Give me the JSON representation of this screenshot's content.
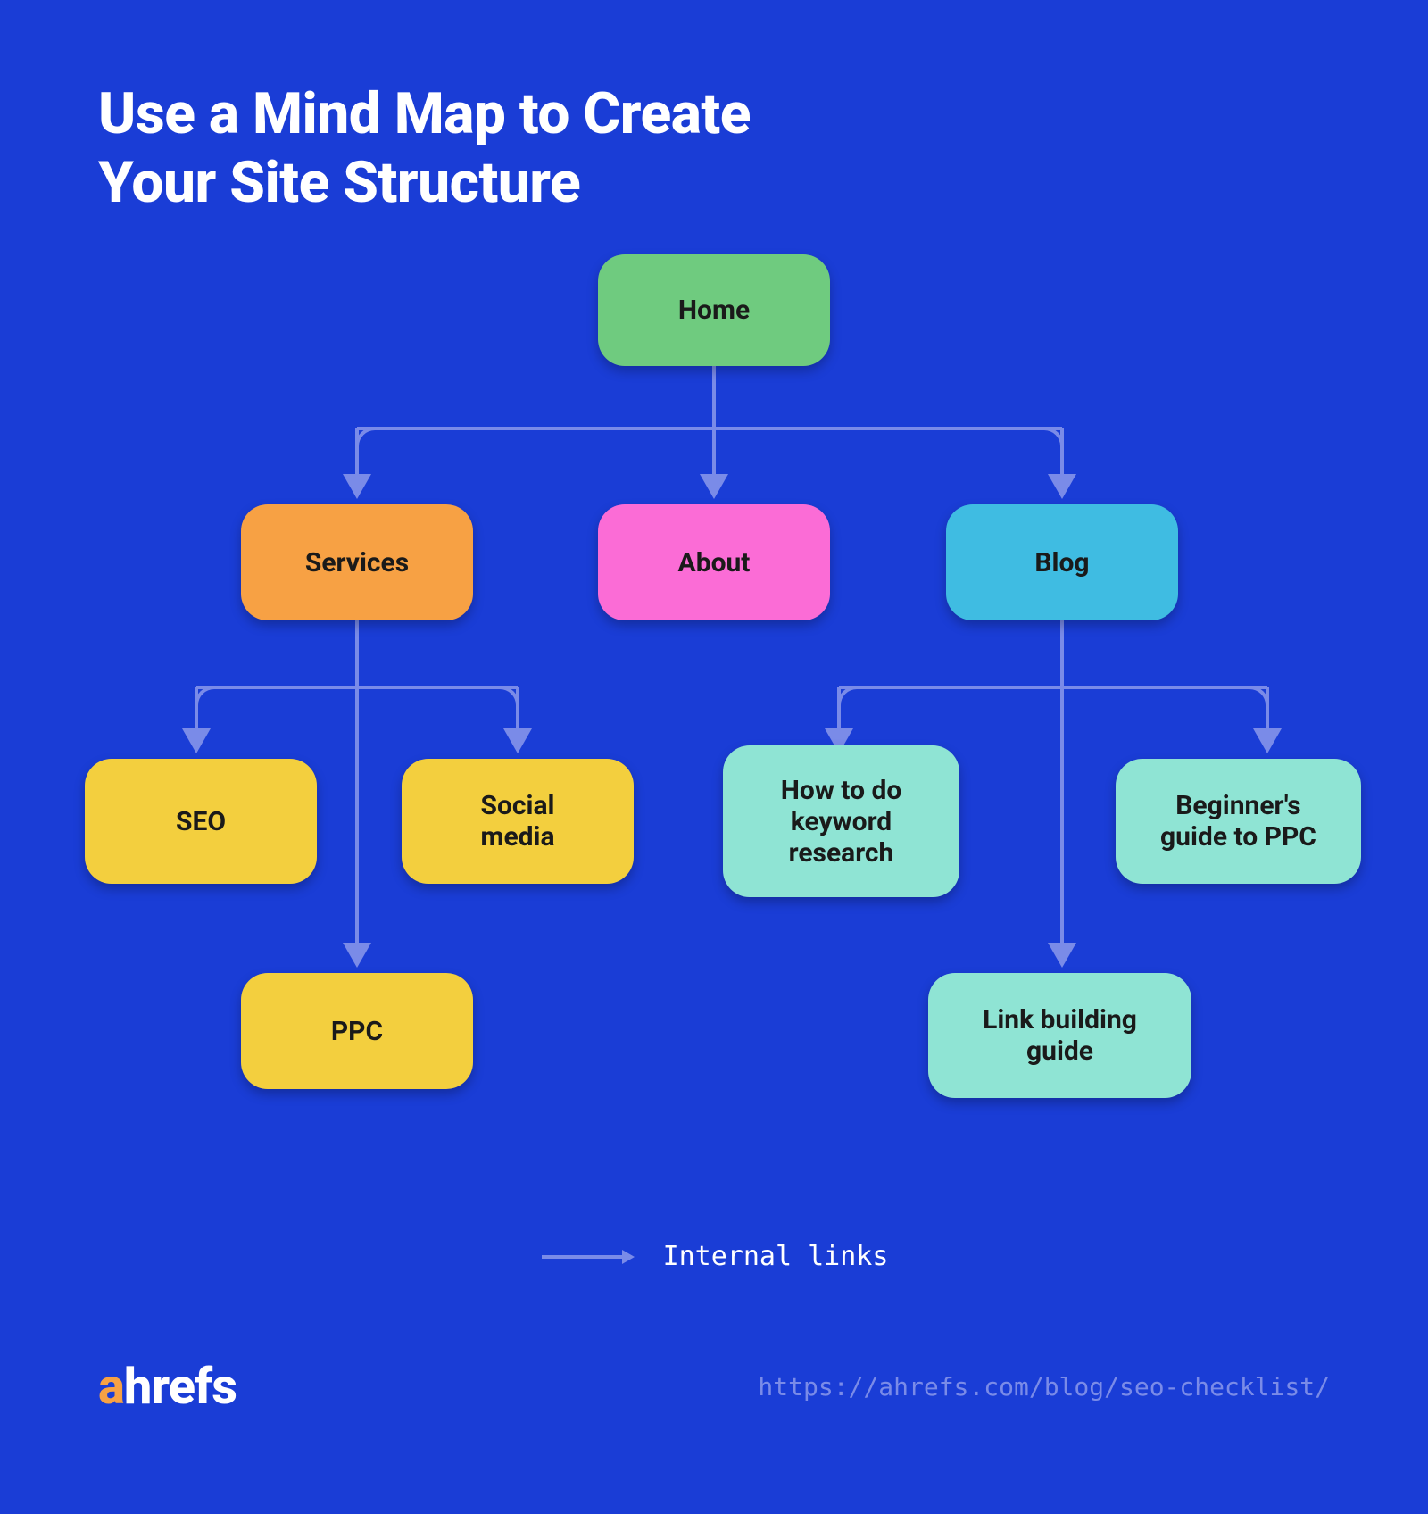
{
  "title": "Use a Mind Map to Create\nYour Site Structure",
  "nodes": {
    "home": "Home",
    "services": "Services",
    "about": "About",
    "blog": "Blog",
    "seo": "SEO",
    "social": "Social\nmedia",
    "ppc": "PPC",
    "how_keyword": "How to do\nkeyword\nresearch",
    "beginners_ppc": "Beginner's\nguide to PPC",
    "link_building": "Link building\nguide"
  },
  "legend": {
    "label": "Internal links"
  },
  "footer": {
    "logo_accent": "a",
    "logo_rest": "hrefs",
    "url": "https://ahrefs.com/blog/seo-checklist/"
  },
  "colors": {
    "background": "#1a3dd6",
    "green": "#6fcb7f",
    "orange": "#f7a144",
    "pink": "#fb6cd6",
    "blue": "#3fbce2",
    "yellow": "#f3cf3e",
    "teal": "#8fe4d4",
    "connector": "#7a8be8"
  },
  "chart_data": {
    "type": "tree",
    "title": "Use a Mind Map to Create Your Site Structure",
    "legend": "Internal links",
    "root": {
      "label": "Home",
      "children": [
        {
          "label": "Services",
          "children": [
            {
              "label": "SEO"
            },
            {
              "label": "Social media"
            },
            {
              "label": "PPC"
            }
          ]
        },
        {
          "label": "About"
        },
        {
          "label": "Blog",
          "children": [
            {
              "label": "How to do keyword research"
            },
            {
              "label": "Beginner's guide to PPC"
            },
            {
              "label": "Link building guide"
            }
          ]
        }
      ]
    }
  }
}
